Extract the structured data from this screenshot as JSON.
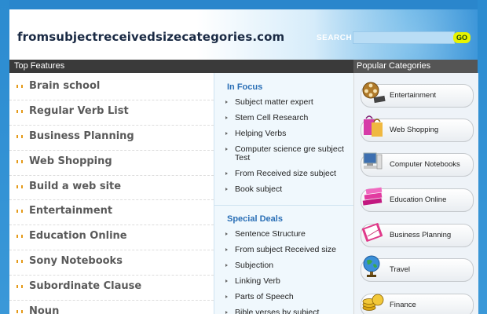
{
  "header": {
    "site_title": "fromsubjectreceivedsizecategories.com",
    "search_label": "SEARCH",
    "search_value": "",
    "go_label": "GO"
  },
  "top_features": {
    "heading": "Top Features",
    "items": [
      "Brain school",
      "Regular Verb List",
      "Business Planning",
      "Web Shopping",
      "Build a web site",
      "Entertainment",
      "Education Online",
      "Sony Notebooks",
      "Subordinate Clause",
      "Noun"
    ]
  },
  "in_focus": {
    "heading": "In Focus",
    "items": [
      "Subject matter expert",
      "Stem Cell Research",
      "Helping Verbs",
      "Computer science gre subject Test",
      "From Received size subject",
      "Book subject"
    ]
  },
  "special_deals": {
    "heading": "Special Deals",
    "items": [
      "Sentence Structure",
      "From subject Received size",
      "Subjection",
      "Linking Verb",
      "Parts of Speech",
      "Bible verses by subject"
    ]
  },
  "popular_categories": {
    "heading": "Popular Categories",
    "items": [
      {
        "label": "Entertainment",
        "icon": "film-reel-icon"
      },
      {
        "label": "Web Shopping",
        "icon": "shopping-bag-icon"
      },
      {
        "label": "Computer Notebooks",
        "icon": "computer-icon"
      },
      {
        "label": "Education Online",
        "icon": "books-icon"
      },
      {
        "label": "Business Planning",
        "icon": "notebook-icon"
      },
      {
        "label": "Travel",
        "icon": "globe-icon"
      },
      {
        "label": "Finance",
        "icon": "coins-icon"
      }
    ]
  },
  "colors": {
    "background_blue": "#2a86cc",
    "heading_blue": "#2a6fb6",
    "bullet_orange": "#e59b1a",
    "go_button": "#e8f400",
    "bar_dark": "#3a3a3a"
  }
}
